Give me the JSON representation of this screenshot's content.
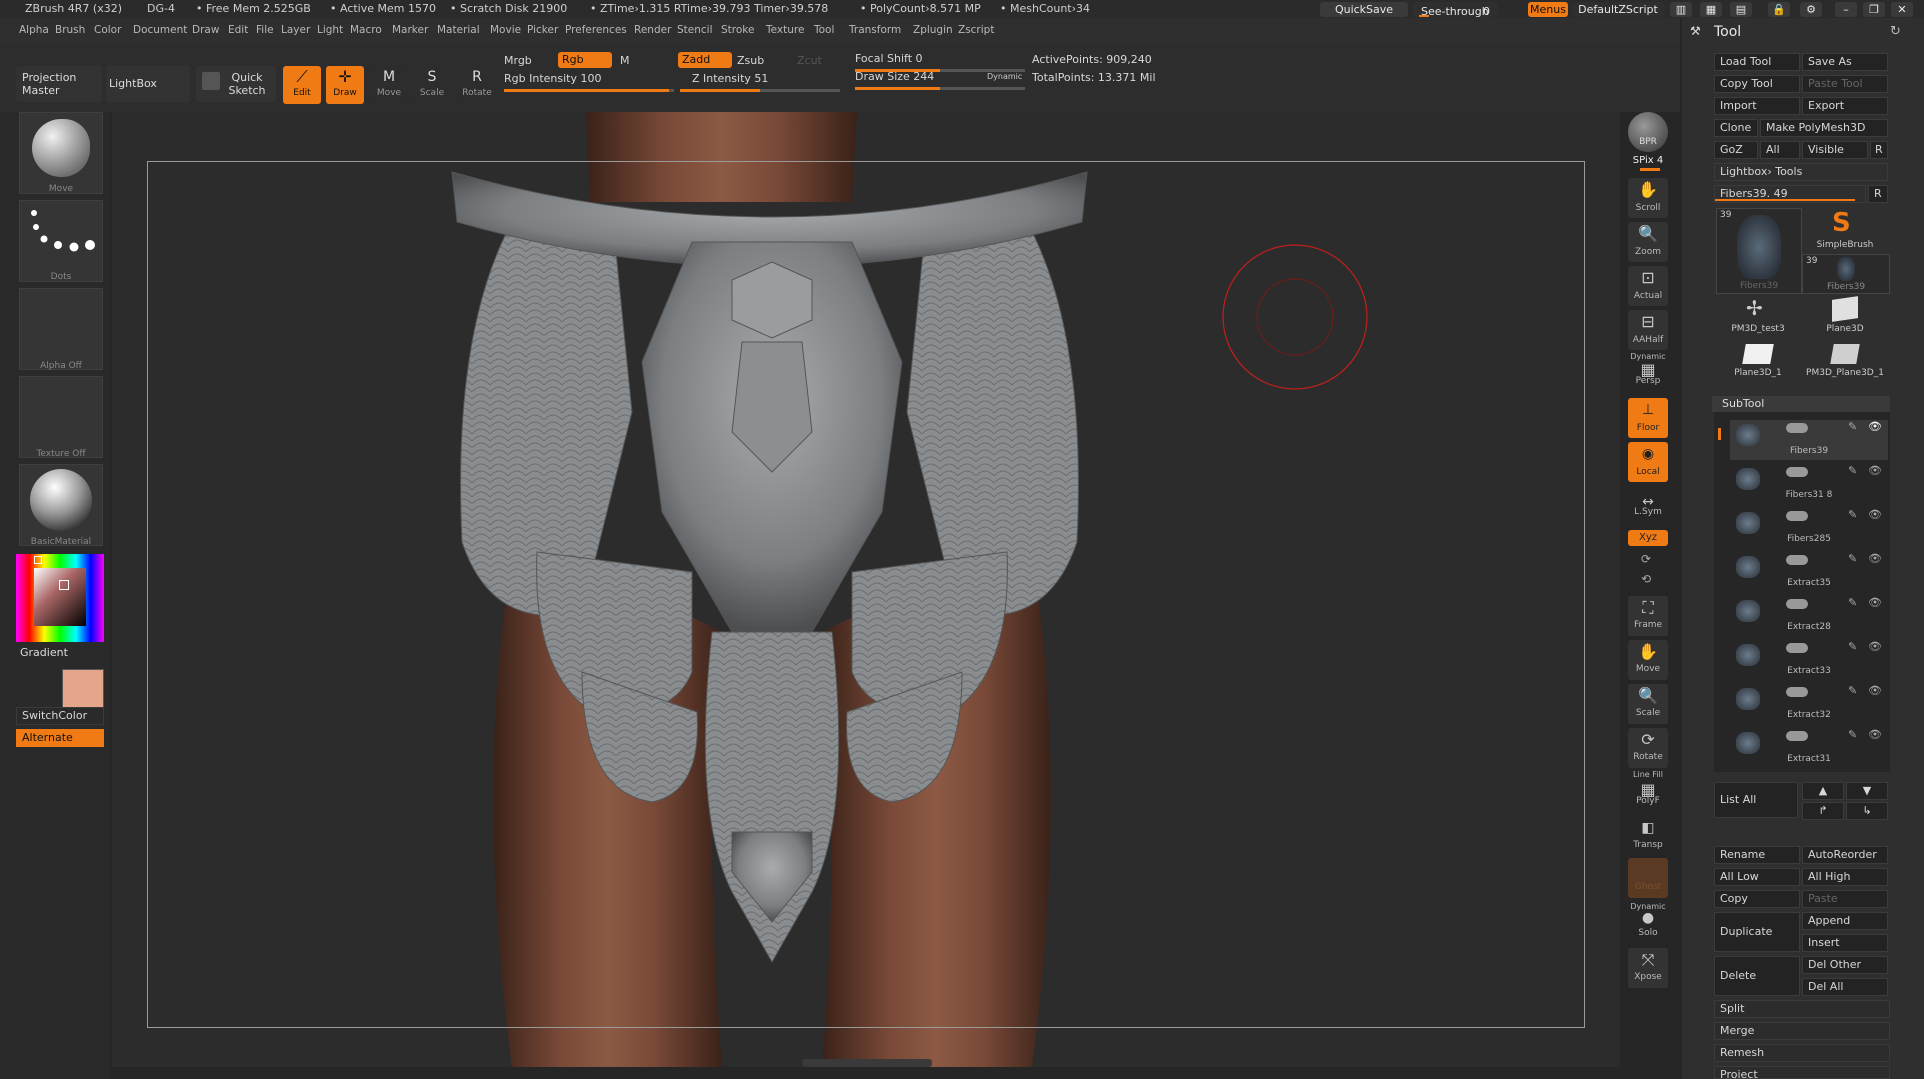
{
  "title_bar": {
    "app": "ZBrush 4R7 (x32)",
    "doc": "DG-4",
    "free_mem": "• Free Mem 2.525GB",
    "active_mem": "• Active Mem 1570",
    "scratch": "• Scratch Disk 21900",
    "ztime": "• ZTime›1.315 RTime›39.793 Timer›39.578",
    "polycount": "• PolyCount›8.571 MP",
    "meshcount": "• MeshCount›34",
    "quicksave": "QuickSave",
    "see_through": "See-through",
    "see_through_value": "0",
    "menus": "Menus",
    "script": "DefaultZScript"
  },
  "menu_bar": [
    "Alpha",
    "Brush",
    "Color",
    "Document",
    "Draw",
    "Edit",
    "File",
    "Layer",
    "Light",
    "Macro",
    "Marker",
    "Material",
    "Movie",
    "Picker",
    "Preferences",
    "Render",
    "Stencil",
    "Stroke",
    "Texture",
    "Tool",
    "Transform",
    "Zplugin",
    "Zscript"
  ],
  "top_toolbar": {
    "projection_master": "Projection Master",
    "lightbox": "LightBox",
    "quick_sketch": "Quick Sketch",
    "edit": "Edit",
    "draw": "Draw",
    "move": "Move",
    "scale": "Scale",
    "rotate": "Rotate",
    "mrgb": "Mrgb",
    "rgb": "Rgb",
    "m": "M",
    "rgb_intensity": "Rgb Intensity 100",
    "zadd": "Zadd",
    "zsub": "Zsub",
    "zcut": "Zcut",
    "z_intensity": "Z Intensity 51",
    "focal_shift": "Focal Shift 0",
    "draw_size": "Draw Size 244",
    "dynamic": "Dynamic",
    "active_points": "ActivePoints: 909,240",
    "total_points": "TotalPoints: 13.371 Mil"
  },
  "left_shelf": {
    "brush": "Move",
    "stroke": "Dots",
    "alpha": "Alpha Off",
    "texture": "Texture Off",
    "material": "BasicMaterial",
    "gradient": "Gradient",
    "switch_color": "SwitchColor",
    "alternate": "Alternate",
    "main_color": "#e5a58a"
  },
  "right_shelf": [
    {
      "name": "bpr",
      "label": "BPR"
    },
    {
      "name": "spix",
      "label": "SPix 4"
    },
    {
      "name": "scroll",
      "label": "Scroll"
    },
    {
      "name": "zoom",
      "label": "Zoom"
    },
    {
      "name": "actual",
      "label": "Actual"
    },
    {
      "name": "aahalf",
      "label": "AAHalf"
    },
    {
      "name": "persp",
      "label": "Persp"
    },
    {
      "name": "dynamic",
      "label": "Dynamic"
    },
    {
      "name": "floor",
      "label": "Floor"
    },
    {
      "name": "local",
      "label": "Local"
    },
    {
      "name": "lsym",
      "label": "L.Sym"
    },
    {
      "name": "xyz",
      "label": "Xyz"
    },
    {
      "name": "frame",
      "label": "Frame"
    },
    {
      "name": "move",
      "label": "Move"
    },
    {
      "name": "scale",
      "label": "Scale"
    },
    {
      "name": "rotate",
      "label": "Rotate"
    },
    {
      "name": "linefill",
      "label": "Line Fill"
    },
    {
      "name": "polyf",
      "label": "PolyF"
    },
    {
      "name": "transp",
      "label": "Transp"
    },
    {
      "name": "ghost",
      "label": "Ghost"
    },
    {
      "name": "dynamic2",
      "label": "Dynamic"
    },
    {
      "name": "solo",
      "label": "Solo"
    },
    {
      "name": "xpose",
      "label": "Xpose"
    }
  ],
  "tool_panel": {
    "title": "Tool",
    "buttons": {
      "load_tool": "Load Tool",
      "save_as": "Save As",
      "copy_tool": "Copy Tool",
      "paste_tool": "Paste Tool",
      "import": "Import",
      "export": "Export",
      "clone": "Clone",
      "make_polymesh": "Make PolyMesh3D",
      "goz": "GoZ",
      "all": "All",
      "visible": "Visible",
      "r": "R"
    },
    "lightbox_tools": "Lightbox› Tools",
    "current_tool": "Fibers39. 49",
    "tools": [
      {
        "name": "Fibers39",
        "badge": "39"
      },
      {
        "name": "SimpleBrush",
        "badge": ""
      },
      {
        "name": "Fibers39",
        "badge": "39"
      },
      {
        "name": "PM3D_test3",
        "badge": ""
      },
      {
        "name": "Plane3D",
        "badge": ""
      },
      {
        "name": "Plane3D_1",
        "badge": ""
      },
      {
        "name": "PM3D_Plane3D_1",
        "badge": ""
      }
    ],
    "subtool_title": "SubTool",
    "subtools": [
      "Fibers39",
      "Fibers31 8",
      "Fibers285",
      "Extract35",
      "Extract28",
      "Extract33",
      "Extract32",
      "Extract31"
    ],
    "list_all": "List All",
    "actions": {
      "rename": "Rename",
      "auto_reorder": "AutoReorder",
      "all_low": "All Low",
      "all_high": "All High",
      "copy": "Copy",
      "paste": "Paste",
      "duplicate": "Duplicate",
      "append": "Append",
      "insert": "Insert",
      "delete": "Delete",
      "del_other": "Del Other",
      "del_all": "Del All",
      "split": "Split",
      "merge": "Merge",
      "remesh": "Remesh",
      "project": "Project"
    }
  }
}
